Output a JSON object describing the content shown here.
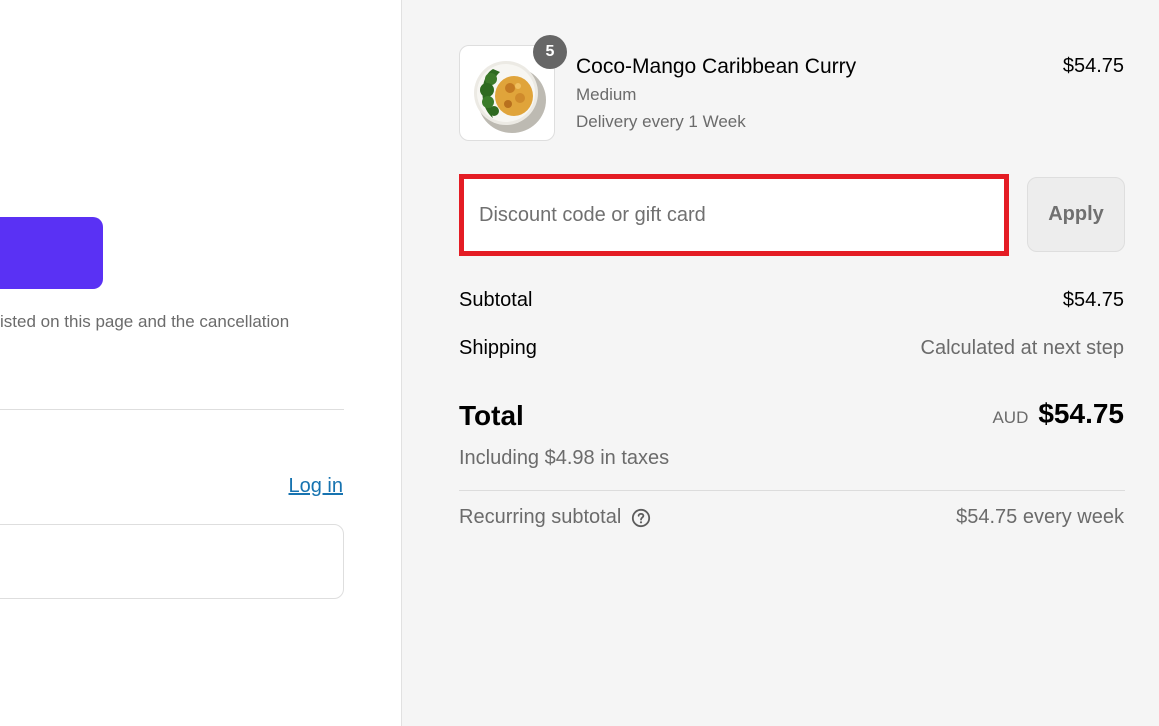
{
  "left": {
    "notice_text": "isted on this page and the cancellation",
    "login_link": "Log in"
  },
  "order": {
    "item": {
      "quantity": "5",
      "title": "Coco-Mango Caribbean Curry",
      "variant": "Medium",
      "plan": "Delivery every 1 Week",
      "price": "$54.75",
      "image_icon": "curry-bowl-thumbnail"
    },
    "discount": {
      "placeholder": "Discount code or gift card",
      "apply_label": "Apply"
    },
    "subtotal": {
      "label": "Subtotal",
      "value": "$54.75"
    },
    "shipping": {
      "label": "Shipping",
      "value": "Calculated at next step"
    },
    "total": {
      "label": "Total",
      "currency": "AUD",
      "value": "$54.75",
      "tax_note": "Including $4.98 in taxes"
    },
    "recurring": {
      "label": "Recurring subtotal",
      "value": "$54.75 every week",
      "help_icon": "question-circle-icon"
    }
  },
  "colors": {
    "pay_button": "#5a31f4",
    "link": "#1773b0",
    "highlight_border": "#e41c24",
    "summary_background": "#f5f5f5"
  }
}
